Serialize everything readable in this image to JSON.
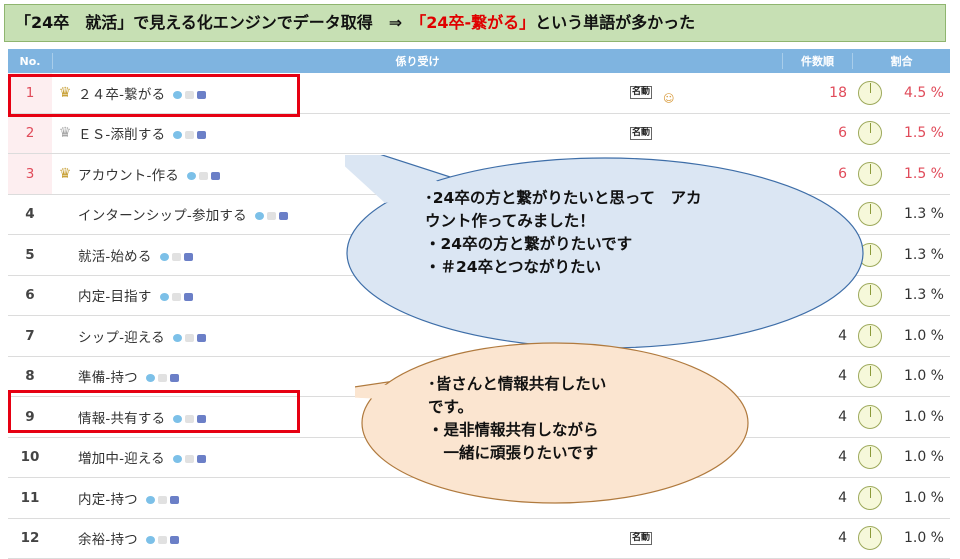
{
  "banner": {
    "part1": "「24卒　就活」で見える化エンジンでデータ取得　⇒　",
    "highlight": "「24卒-繋がる」",
    "part2": "という単語が多かった"
  },
  "table": {
    "headers": {
      "no": "No.",
      "word": "係り受け",
      "count": "件数順",
      "ratio": "割合"
    },
    "rows": [
      {
        "no": "1",
        "word": "２４卒-繋がる",
        "pos": "名動",
        "count": "18",
        "pct": "4.5 %",
        "crown": "gold"
      },
      {
        "no": "2",
        "word": "ＥＳ-添削する",
        "pos": "名動",
        "count": "6",
        "pct": "1.5 %",
        "crown": "silver"
      },
      {
        "no": "3",
        "word": "アカウント-作る",
        "pos": "",
        "count": "6",
        "pct": "1.5 %",
        "crown": "bronze"
      },
      {
        "no": "4",
        "word": "インターンシップ-参加する",
        "pos": "",
        "count": "",
        "pct": "1.3 %",
        "crown": ""
      },
      {
        "no": "5",
        "word": "就活-始める",
        "pos": "",
        "count": "",
        "pct": "1.3 %",
        "crown": ""
      },
      {
        "no": "6",
        "word": "内定-目指す",
        "pos": "",
        "count": "",
        "pct": "1.3 %",
        "crown": ""
      },
      {
        "no": "7",
        "word": "シップ-迎える",
        "pos": "",
        "count": "4",
        "pct": "1.0 %",
        "crown": ""
      },
      {
        "no": "8",
        "word": "準備-持つ",
        "pos": "",
        "count": "4",
        "pct": "1.0 %",
        "crown": ""
      },
      {
        "no": "9",
        "word": "情報-共有する",
        "pos": "",
        "count": "4",
        "pct": "1.0 %",
        "crown": ""
      },
      {
        "no": "10",
        "word": "増加中-迎える",
        "pos": "",
        "count": "4",
        "pct": "1.0 %",
        "crown": ""
      },
      {
        "no": "11",
        "word": "内定-持つ",
        "pos": "",
        "count": "4",
        "pct": "1.0 %",
        "crown": ""
      },
      {
        "no": "12",
        "word": "余裕-持つ",
        "pos": "名動",
        "count": "4",
        "pct": "1.0 %",
        "crown": ""
      }
    ]
  },
  "callout1": {
    "line1": "･24卒の方と繋がりたいと思って　アカ",
    "line2": "ウント作ってみました！",
    "line3": "・24卒の方と繋がりたいです",
    "line4": "・＃24卒とつながりたい"
  },
  "callout2": {
    "line1": "･皆さんと情報共有したい",
    "line2": "です。",
    "line3": "・是非情報共有しながら",
    "line4": "　一緒に頑張りたいです"
  },
  "colors": {
    "banner_bg": "#c7e0b4",
    "header_bg": "#7fb4e0",
    "highlight": "#e00000",
    "callout1_fill": "#dbe6f3",
    "callout2_fill": "#fbe5d0"
  }
}
